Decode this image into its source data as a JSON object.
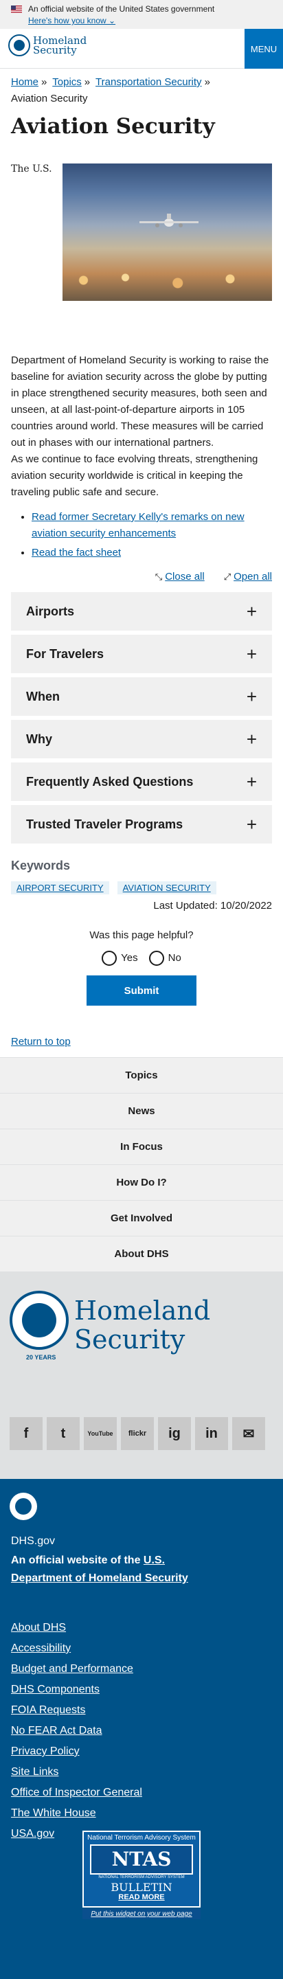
{
  "gov_banner": {
    "official_text": "An official website of the United States government",
    "how_you_know": "Here's how you know ⌄"
  },
  "header": {
    "logo_line1": "Homeland",
    "logo_line2": "Security",
    "menu_label": "MENU"
  },
  "breadcrumb": {
    "home": "Home",
    "topics": "Topics",
    "transportation": "Transportation Security",
    "current": "Aviation Security",
    "separator": "»"
  },
  "page": {
    "title": "Aviation Security",
    "intro_fragment": "The U.S.",
    "paragraph1": "Department of Homeland Security is working to raise the baseline for aviation security across the globe by putting in place strengthened security measures, both seen and unseen, at all last-point-of-departure airports in 105 countries around world. These measures will be carried out in phases with our international partners.",
    "paragraph2": "As we continue to face evolving threats, strengthening aviation security worldwide is critical in keeping the traveling public safe and secure.",
    "links": [
      "Read former Secretary Kelly's remarks on new aviation security enhancements",
      "Read the fact sheet"
    ]
  },
  "accordion": {
    "close_all": "Close all",
    "open_all": "Open all",
    "items": [
      "Airports",
      "For Travelers",
      "When",
      "Why",
      "Frequently Asked Questions",
      "Trusted Traveler Programs"
    ]
  },
  "keywords": {
    "heading": "Keywords",
    "tags": [
      "AIRPORT SECURITY",
      "AVIATION SECURITY"
    ]
  },
  "last_updated": "Last Updated: 10/20/2022",
  "feedback": {
    "question": "Was this page helpful?",
    "yes": "Yes",
    "no": "No",
    "submit": "Submit"
  },
  "return_to_top": "Return to top",
  "footer_nav": [
    "Topics",
    "News",
    "In Focus",
    "How Do I?",
    "Get Involved",
    "About DHS"
  ],
  "footer_logo": {
    "line1": "Homeland",
    "line2": "Security",
    "years": "20 YEARS"
  },
  "social": [
    "f",
    "t",
    "YouTube",
    "flickr",
    "ig",
    "in",
    "mail"
  ],
  "footer": {
    "domain": "DHS.gov",
    "official_prefix": "An official website of the ",
    "official_link": "U.S. Department of Homeland Security",
    "links": [
      "About DHS",
      "Accessibility",
      "Budget and Performance",
      "DHS Components",
      "FOIA Requests",
      "No FEAR Act Data",
      "Privacy Policy",
      "Site Links",
      "Office of Inspector General",
      "The White House",
      "USA.gov"
    ]
  },
  "ntas": {
    "top": "National Terrorism Advisory System",
    "logo": "NTAS",
    "sub": "NATIONAL TERRORISM ADVISORY SYSTEM",
    "bulletin": "BULLETIN",
    "read_more": "READ MORE",
    "widget": "Put this widget on your web page"
  }
}
